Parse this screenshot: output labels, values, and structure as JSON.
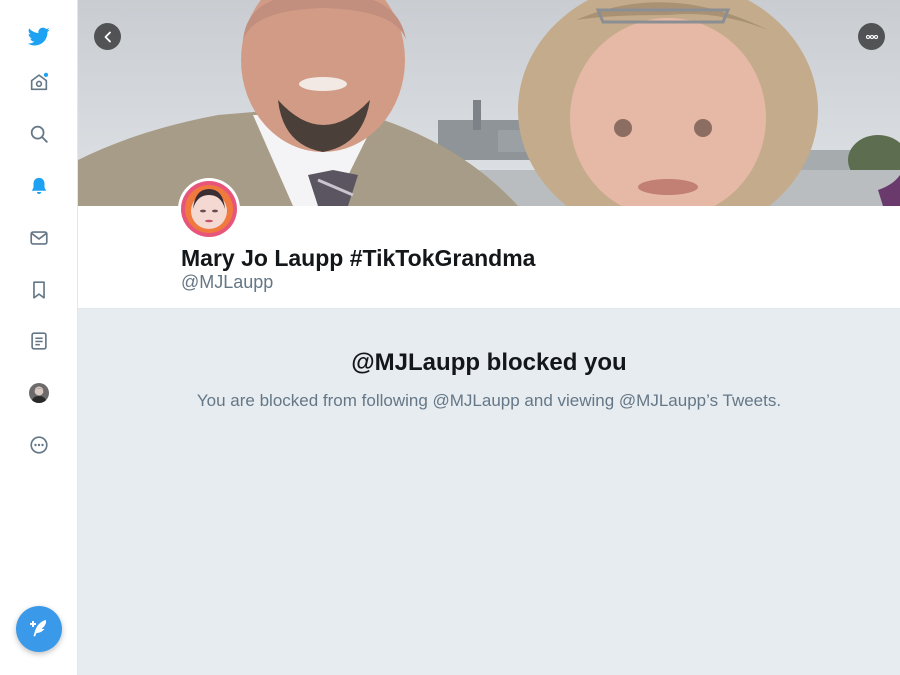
{
  "sidebar": {
    "items": [
      {
        "name": "twitter-logo-icon"
      },
      {
        "name": "home-icon"
      },
      {
        "name": "search-icon"
      },
      {
        "name": "notifications-icon"
      },
      {
        "name": "messages-icon"
      },
      {
        "name": "bookmarks-icon"
      },
      {
        "name": "lists-icon"
      },
      {
        "name": "profile-avatar-icon"
      },
      {
        "name": "more-icon"
      }
    ],
    "compose": {
      "name": "compose-tweet-icon"
    }
  },
  "colors": {
    "accent": "#1da1f2",
    "compose": "#3a99e8",
    "blocked_bg": "#e6ecf0",
    "text_primary": "#14171a",
    "text_secondary": "#657786"
  },
  "profile": {
    "display_name": "Mary Jo Laupp #TikTokGrandma",
    "handle": "@MJLaupp"
  },
  "blocked": {
    "title": "@MJLaupp blocked you",
    "message": "You are blocked from following @MJLaupp and viewing @MJLaupp’s Tweets."
  }
}
